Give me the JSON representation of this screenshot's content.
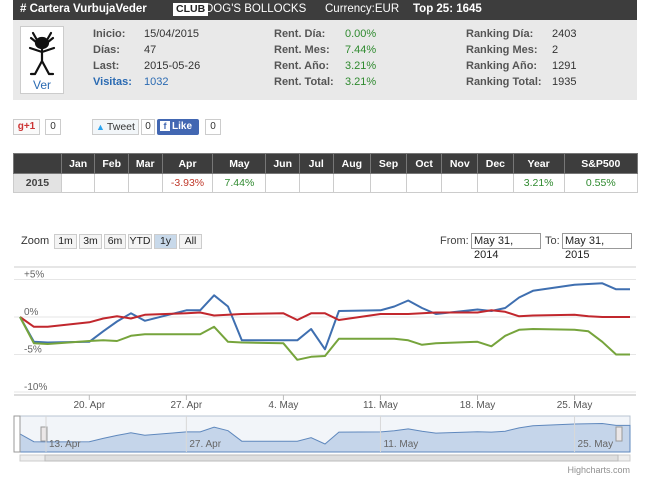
{
  "header": {
    "title": "# Cartera VurbujaVeder",
    "club": "CLUB",
    "name": "DOG'S BOLLOCKS",
    "currency": "Currency:EUR",
    "top": "Top 25: 1645"
  },
  "avatar": {
    "link": "Ver"
  },
  "info": {
    "col1": [
      {
        "label": "Inicio:",
        "value": "15/04/2015"
      },
      {
        "label": "Días:",
        "value": "47"
      },
      {
        "label": "Last:",
        "value": "2015-05-26"
      },
      {
        "label": "Visitas:",
        "value": "1032"
      }
    ],
    "col2": [
      {
        "label": "Rent. Día:",
        "value": "0.00%"
      },
      {
        "label": "Rent. Mes:",
        "value": "7.44%"
      },
      {
        "label": "Rent. Año:",
        "value": "3.21%"
      },
      {
        "label": "Rent. Total:",
        "value": "3.21%"
      }
    ],
    "col3": [
      {
        "label": "Ranking Día:",
        "value": "2403"
      },
      {
        "label": "Ranking Mes:",
        "value": "2"
      },
      {
        "label": "Ranking Año:",
        "value": "1291"
      },
      {
        "label": "Ranking Total:",
        "value": "1935"
      }
    ]
  },
  "social": {
    "gplus": "g+1",
    "gplus_count": "0",
    "tweet": "Tweet",
    "tweet_count": "0",
    "like": "Like",
    "like_count": "0"
  },
  "months_table": {
    "headers": [
      "",
      "Jan",
      "Feb",
      "Mar",
      "Apr",
      "May",
      "Jun",
      "Jul",
      "Aug",
      "Sep",
      "Oct",
      "Nov",
      "Dec",
      "Year",
      "S&P500"
    ],
    "row": [
      "2015",
      "",
      "",
      "",
      "-3.93%",
      "7.44%",
      "",
      "",
      "",
      "",
      "",
      "",
      "",
      "3.21%",
      "0.55%"
    ]
  },
  "toolbar": {
    "zoom_label": "Zoom",
    "buttons": [
      "1m",
      "3m",
      "6m",
      "YTD",
      "1y",
      "All"
    ],
    "selected": "1y",
    "from_label": "From:",
    "from_value": "May 31, 2014",
    "to_label": "To:",
    "to_value": "May 31, 2015"
  },
  "chart_data": {
    "type": "line",
    "y_ticks": [
      "+5%",
      "0%",
      "-5%",
      "-10%"
    ],
    "y_range": [
      -10,
      6
    ],
    "x_ticks": [
      "20. Apr",
      "27. Apr",
      "4. May",
      "11. May",
      "18. May",
      "25. May"
    ],
    "navigator_ticks": [
      "13. Apr",
      "27. Apr",
      "11. May",
      "25. May"
    ],
    "credits": "Highcharts.com",
    "x": [
      "2015-04-15",
      "2015-04-16",
      "2015-04-17",
      "2015-04-20",
      "2015-04-21",
      "2015-04-22",
      "2015-04-23",
      "2015-04-24",
      "2015-04-27",
      "2015-04-28",
      "2015-04-29",
      "2015-04-30",
      "2015-05-01",
      "2015-05-04",
      "2015-05-05",
      "2015-05-06",
      "2015-05-07",
      "2015-05-08",
      "2015-05-11",
      "2015-05-12",
      "2015-05-13",
      "2015-05-14",
      "2015-05-15",
      "2015-05-18",
      "2015-05-19",
      "2015-05-20",
      "2015-05-21",
      "2015-05-22",
      "2015-05-25",
      "2015-05-26",
      "2015-05-27",
      "2015-05-28",
      "2015-05-29"
    ],
    "series": [
      {
        "color": "#3f6fb0",
        "values": [
          0,
          -3.3,
          -3.4,
          -3.3,
          -1.9,
          -0.6,
          0.5,
          -0.5,
          0.9,
          0.9,
          2.9,
          1.4,
          -3.1,
          -3.1,
          -3.1,
          -1.6,
          -4.3,
          0.8,
          0.9,
          1.4,
          2.2,
          1.2,
          0.4,
          1.0,
          0.8,
          1.2,
          2.6,
          3.5,
          4.3,
          4.4,
          4.5,
          3.7,
          3.7
        ]
      },
      {
        "color": "#c1272d",
        "values": [
          0,
          -1.3,
          -1.3,
          -0.7,
          -0.2,
          0.1,
          -0.2,
          0.3,
          0.5,
          0.6,
          0.2,
          0.3,
          0.4,
          0.5,
          -0.4,
          0.5,
          0.5,
          -0.4,
          0.4,
          0.4,
          0.4,
          0.5,
          0.6,
          0.6,
          0.9,
          0.7,
          0.1,
          0.2,
          0.3,
          0.1,
          0.0,
          0.0,
          0.0
        ]
      },
      {
        "color": "#76a43c",
        "values": [
          0,
          -3.5,
          -3.6,
          -3.2,
          -3.1,
          -3.2,
          -2.5,
          -2.3,
          -2.3,
          -2.3,
          -1.3,
          -3.3,
          -3.4,
          -3.5,
          -5.7,
          -5.3,
          -5.2,
          -2.9,
          -2.9,
          -2.9,
          -3.1,
          -3.7,
          -3.5,
          -3.3,
          -3.9,
          -2.5,
          -1.7,
          -1.6,
          -1.7,
          -1.9,
          -3.3,
          -5.0,
          -5.0
        ]
      }
    ],
    "navigator_values": [
      0,
      -3.3,
      -3.4,
      -3.3,
      -1.9,
      -0.6,
      0.5,
      -0.5,
      0.9,
      0.9,
      2.9,
      1.4,
      -3.1,
      -3.1,
      -3.1,
      -1.6,
      -4.3,
      0.8,
      0.9,
      1.4,
      2.2,
      1.2,
      0.4,
      1.0,
      0.8,
      1.2,
      2.6,
      3.5,
      4.3,
      4.4,
      4.5,
      3.7,
      3.7
    ]
  }
}
